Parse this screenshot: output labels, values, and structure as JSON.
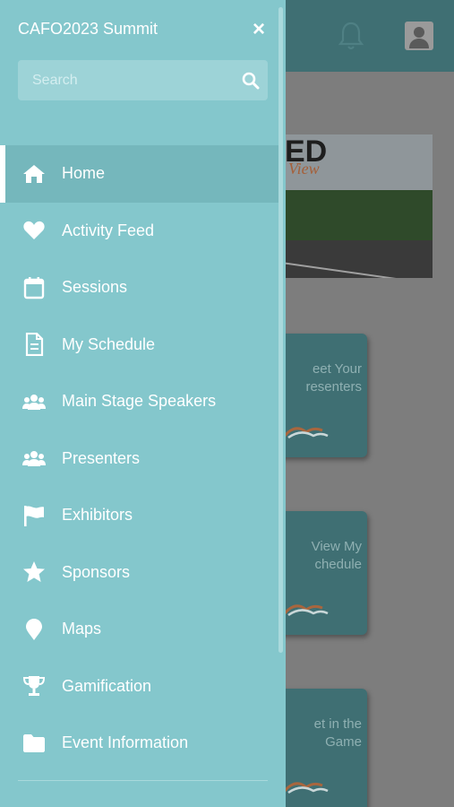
{
  "drawer": {
    "title": "CAFO2023 Summit",
    "close_glyph": "×",
    "search": {
      "placeholder": "Search",
      "value": ""
    },
    "items": [
      {
        "label": "Home",
        "icon": "home-icon",
        "active": true
      },
      {
        "label": "Activity Feed",
        "icon": "heart-icon",
        "active": false
      },
      {
        "label": "Sessions",
        "icon": "calendar-icon",
        "active": false
      },
      {
        "label": "My Schedule",
        "icon": "document-icon",
        "active": false
      },
      {
        "label": "Main Stage Speakers",
        "icon": "users-icon",
        "active": false
      },
      {
        "label": "Presenters",
        "icon": "users-icon",
        "active": false
      },
      {
        "label": "Exhibitors",
        "icon": "flag-icon",
        "active": false
      },
      {
        "label": "Sponsors",
        "icon": "star-icon",
        "active": false
      },
      {
        "label": "Maps",
        "icon": "map-pin-icon",
        "active": false
      },
      {
        "label": "Gamification",
        "icon": "trophy-icon",
        "active": false
      },
      {
        "label": "Event Information",
        "icon": "folder-icon",
        "active": false
      }
    ]
  },
  "background": {
    "banner": {
      "big_text": "ED",
      "script_text": "View"
    },
    "cards": [
      {
        "text": "eet Your\nresenters"
      },
      {
        "text": "View My\nchedule"
      },
      {
        "text": "et in the\nGame"
      }
    ]
  },
  "colors": {
    "drawer_bg": "#84c7cc",
    "active_item_bg": "#75b7bc",
    "header_bg": "#3f6f73",
    "text": "#ffffff"
  }
}
